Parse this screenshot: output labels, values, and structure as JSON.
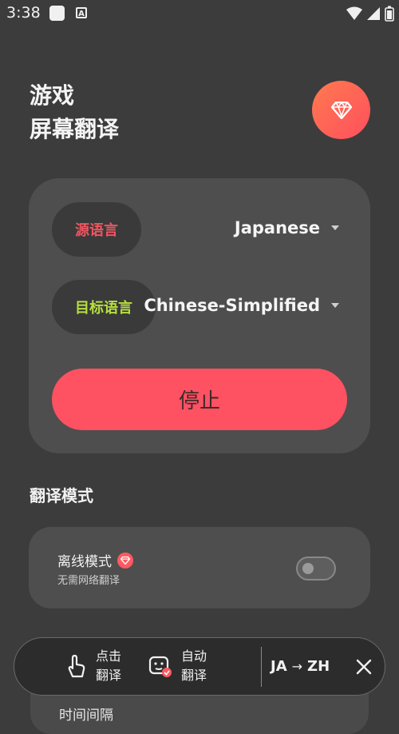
{
  "status_bar": {
    "time": "3:38",
    "a_icon": "A"
  },
  "header": {
    "title_line1": "游戏",
    "title_line2": "屏幕翻译"
  },
  "languages": {
    "source_label": "源语言",
    "source_value": "Japanese",
    "target_label": "目标语言",
    "target_value": "Chinese-Simplified",
    "stop_label": "停止"
  },
  "mode_section": {
    "title": "翻译模式",
    "offline_title": "离线模式",
    "offline_subtitle": "无需网络翻译",
    "offline_enabled": false
  },
  "next_card": {
    "label": "时间间隔"
  },
  "floating_bar": {
    "tap_line1": "点击",
    "tap_line2": "翻译",
    "auto_line1": "自动",
    "auto_line2": "翻译",
    "pair_from": "JA",
    "pair_arrow": "→",
    "pair_to": "ZH"
  },
  "colors": {
    "background": "#3c3c3c",
    "card": "#4e4e4e",
    "accent_red": "#fe5162",
    "source_label": "#ef5560",
    "target_label": "#b7e03e"
  }
}
